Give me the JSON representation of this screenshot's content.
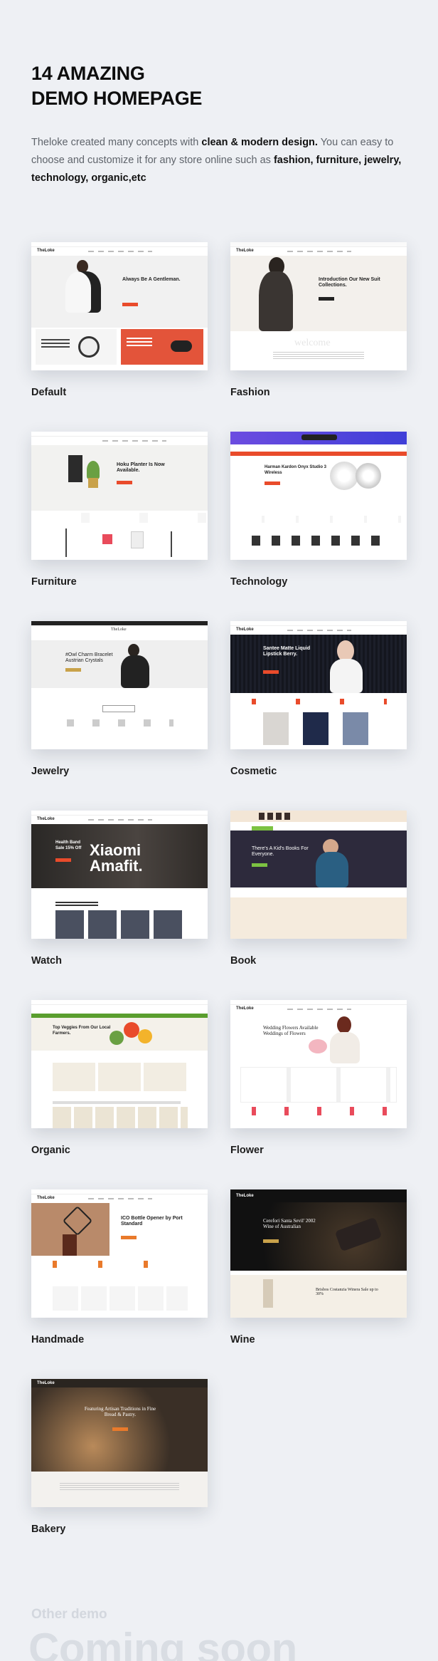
{
  "header": {
    "title": "14 AMAZING\nDEMO HOMEPAGE",
    "intro_part1": "Theloke created many concepts with ",
    "intro_bold1": "clean & modern design.",
    "intro_part2": " You can easy to choose and customize it for any store online such as ",
    "intro_bold2": "fashion, furniture, jewelry, technology, organic,etc"
  },
  "demos": [
    {
      "label": "Default",
      "thumb": {
        "logo": "TheLoke",
        "hero": "Always Be A Gentleman.",
        "accent": "#e94b2b",
        "theme": "light"
      }
    },
    {
      "label": "Fashion",
      "thumb": {
        "logo": "TheLoke",
        "hero": "Introduction Our New Suit Collections.",
        "accent": "#222222",
        "theme": "light"
      }
    },
    {
      "label": "Furniture",
      "thumb": {
        "logo": "",
        "hero": "Hoku Planter Is Now Available.",
        "accent": "#e94b2b",
        "theme": "light"
      }
    },
    {
      "label": "Technology",
      "thumb": {
        "logo": "",
        "hero": "Harman Kardon Onyx Studio 3 Wireless",
        "accent": "#e94b2b",
        "theme": "purple"
      }
    },
    {
      "label": "Jewelry",
      "thumb": {
        "logo": "",
        "hero": "#Owl Charm Bracelet Austrian Crystals",
        "accent": "#c9a24a",
        "theme": "light"
      }
    },
    {
      "label": "Cosmetic",
      "thumb": {
        "logo": "TheLoke",
        "hero": "Santee Matte Liquid Lipstick Berry.",
        "accent": "#e94b2b",
        "theme": "dark"
      }
    },
    {
      "label": "Watch",
      "thumb": {
        "logo": "TheLoke",
        "hero": "Xiaomi Amafit.",
        "accent": "#e94b2b",
        "theme": "dark"
      }
    },
    {
      "label": "Book",
      "thumb": {
        "logo": "",
        "hero": "There's A Kid's Books For Everyone.",
        "accent": "#7cc242",
        "theme": "dark"
      }
    },
    {
      "label": "Organic",
      "thumb": {
        "logo": "",
        "hero": "Top Veggies From Our Local Farmers.",
        "accent": "#5a9e2e",
        "theme": "light"
      }
    },
    {
      "label": "Flower",
      "thumb": {
        "logo": "TheLoke",
        "hero": "Wedding Flowers Available Weddings of Flowers",
        "accent": "#e94b5b",
        "theme": "light"
      }
    },
    {
      "label": "Handmade",
      "thumb": {
        "logo": "TheLoke",
        "hero": "ICO Bottle Opener by Port Standard",
        "accent": "#e97a2b",
        "theme": "light"
      }
    },
    {
      "label": "Wine",
      "thumb": {
        "logo": "TheLoke",
        "hero": "Cerefori Santa Sevil' 2002 Wine of Australian",
        "accent": "#c9a24a",
        "theme": "dark"
      }
    },
    {
      "label": "Bakery",
      "thumb": {
        "logo": "TheLoke",
        "hero": "Featuring Artisan Traditions in Fine Bread & Pastry.",
        "accent": "#e97a2b",
        "theme": "dark"
      }
    }
  ],
  "footer": {
    "other_demo": "Other demo",
    "coming_soon": "Coming soon"
  }
}
